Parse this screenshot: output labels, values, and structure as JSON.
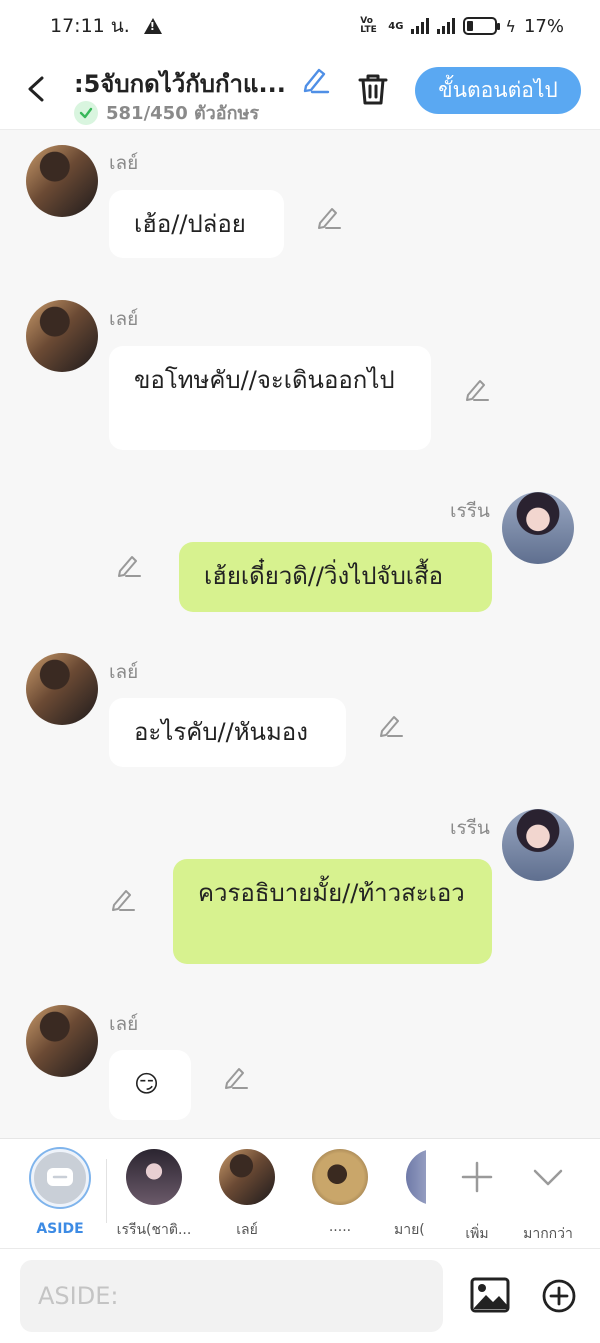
{
  "status_bar": {
    "time": "17:11 น.",
    "network": "4G",
    "volte": "Vo LTE",
    "battery": "17%"
  },
  "header": {
    "title": ":5จับกดไว้กับกำแ...",
    "char_count": "581/450 ตัวอักษร",
    "next_button": "ขั้นตอนต่อไป"
  },
  "messages": [
    {
      "sender": "เลย์",
      "text": "เฮ้อ//ปล่อย",
      "side": "left"
    },
    {
      "sender": "เลย์",
      "text": "ขอโทษคับ//จะเดินออกไป",
      "side": "left"
    },
    {
      "sender": "เรรีน",
      "text": "เฮ้ยเดี๋ยวดิ//วิ่งไปจับเสื้อ",
      "side": "right"
    },
    {
      "sender": "เลย์",
      "text": "อะไรคับ//หันมอง",
      "side": "left"
    },
    {
      "sender": "เรรีน",
      "text": "ควรอธิบายมั้ย//ท้าวสะเอว",
      "side": "right"
    },
    {
      "sender": "เลย์",
      "text": "😏",
      "side": "left"
    }
  ],
  "characters": [
    {
      "label": "ASIDE"
    },
    {
      "label": "เรรีน(ชาติ..."
    },
    {
      "label": "เลย์"
    },
    {
      "label": "....."
    },
    {
      "label": "มาย("
    }
  ],
  "actions": {
    "add_label": "เพิ่ม",
    "more_label": "มากกว่า"
  },
  "composer": {
    "placeholder": "ASIDE:"
  },
  "colors": {
    "accent": "#5aa8f2",
    "bubble_right": "#d7f28f",
    "bubble_left": "#ffffff"
  }
}
